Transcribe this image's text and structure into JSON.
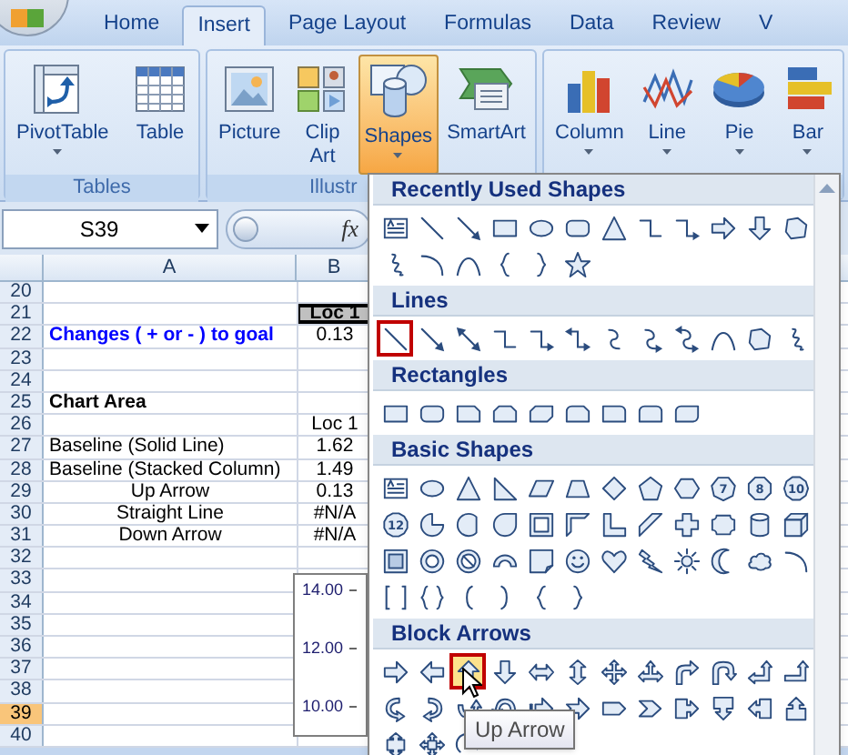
{
  "ribbon_tabs": [
    {
      "label": "Home",
      "selected": false
    },
    {
      "label": "Insert",
      "selected": true
    },
    {
      "label": "Page Layout",
      "selected": false
    },
    {
      "label": "Formulas",
      "selected": false
    },
    {
      "label": "Data",
      "selected": false
    },
    {
      "label": "Review",
      "selected": false
    },
    {
      "label": "V",
      "selected": false
    }
  ],
  "ribbon_groups": [
    {
      "label": "Tables",
      "buttons": [
        {
          "kind": "pivot-table",
          "label": "PivotTable",
          "has_menu": true,
          "selected": false
        },
        {
          "kind": "table",
          "label": "Table",
          "has_menu": false,
          "selected": false
        }
      ]
    },
    {
      "label": "Illustr",
      "buttons": [
        {
          "kind": "picture",
          "label": "Picture",
          "has_menu": false,
          "selected": false
        },
        {
          "kind": "clip-art",
          "label": "Clip Art",
          "has_menu": false,
          "selected": false
        },
        {
          "kind": "shapes",
          "label": "Shapes",
          "has_menu": true,
          "selected": true
        },
        {
          "kind": "smartart",
          "label": "SmartArt",
          "has_menu": false,
          "selected": false
        }
      ]
    },
    {
      "buttons": [
        {
          "kind": "column-chart",
          "label": "Column",
          "has_menu": true,
          "selected": false
        },
        {
          "kind": "line-chart",
          "label": "Line",
          "has_menu": true,
          "selected": false
        },
        {
          "kind": "pie-chart",
          "label": "Pie",
          "has_menu": true,
          "selected": false
        },
        {
          "kind": "bar-chart",
          "label": "Bar",
          "has_menu": true,
          "selected": false
        }
      ]
    }
  ],
  "name_box": {
    "value": "S39"
  },
  "formula_bar": {
    "function_label": "fx"
  },
  "sheet": {
    "columns": [
      {
        "label": "A"
      },
      {
        "label": "B"
      }
    ],
    "rows": [
      {
        "number": "20",
        "selected": false
      },
      {
        "number": "21",
        "selected": false,
        "b": {
          "text": "Loc 1",
          "kind": "header"
        }
      },
      {
        "number": "22",
        "selected": false,
        "a": {
          "text": "Changes ( + or - ) to goal",
          "kind": "goal"
        },
        "b": {
          "text": "0.13",
          "kind": "value"
        }
      },
      {
        "number": "23",
        "selected": false
      },
      {
        "number": "24",
        "selected": false
      },
      {
        "number": "25",
        "selected": false,
        "a": {
          "text": "Chart Area",
          "kind": "title"
        }
      },
      {
        "number": "26",
        "selected": false,
        "b": {
          "text": "Loc 1",
          "kind": "value"
        }
      },
      {
        "number": "27",
        "selected": false,
        "a": {
          "text": "Baseline (Solid Line)",
          "kind": "plain"
        },
        "b": {
          "text": "1.62",
          "kind": "value"
        }
      },
      {
        "number": "28",
        "selected": false,
        "a": {
          "text": "Baseline (Stacked Column)",
          "kind": "plain"
        },
        "b": {
          "text": "1.49",
          "kind": "value"
        }
      },
      {
        "number": "29",
        "selected": false,
        "a": {
          "text": "Up Arrow",
          "kind": "centered"
        },
        "b": {
          "text": "0.13",
          "kind": "value"
        }
      },
      {
        "number": "30",
        "selected": false,
        "a": {
          "text": "Straight Line",
          "kind": "centered"
        },
        "b": {
          "text": "#N/A",
          "kind": "value"
        }
      },
      {
        "number": "31",
        "selected": false,
        "a": {
          "text": "Down Arrow",
          "kind": "centered"
        },
        "b": {
          "text": "#N/A",
          "kind": "value"
        }
      },
      {
        "number": "32",
        "selected": false
      },
      {
        "number": "33",
        "selected": false
      },
      {
        "number": "34",
        "selected": false
      },
      {
        "number": "35",
        "selected": false
      },
      {
        "number": "36",
        "selected": false
      },
      {
        "number": "37",
        "selected": false
      },
      {
        "number": "38",
        "selected": false
      },
      {
        "number": "39",
        "selected": true
      },
      {
        "number": "40",
        "selected": false
      }
    ]
  },
  "chart": {
    "axis_labels": [
      "14.00",
      "12.00",
      "10.00"
    ]
  },
  "shapes_menu": {
    "tooltip": "Up Arrow",
    "sections": [
      {
        "title": "Recently Used Shapes",
        "items": [
          {
            "kind": "text-box",
            "hovered": false,
            "marked": false
          },
          {
            "kind": "line",
            "hovered": false,
            "marked": false
          },
          {
            "kind": "arrow",
            "hovered": false,
            "marked": false
          },
          {
            "kind": "rectangle",
            "hovered": false,
            "marked": false
          },
          {
            "kind": "oval",
            "hovered": false,
            "marked": false
          },
          {
            "kind": "rounded-rectangle",
            "hovered": false,
            "marked": false
          },
          {
            "kind": "triangle",
            "hovered": false,
            "marked": false
          },
          {
            "kind": "elbow-connector",
            "hovered": false,
            "marked": false
          },
          {
            "kind": "elbow-arrow",
            "hovered": false,
            "marked": false
          },
          {
            "kind": "right-arrow",
            "hovered": false,
            "marked": false
          },
          {
            "kind": "down-arrow",
            "hovered": false,
            "marked": false
          },
          {
            "kind": "freeform",
            "hovered": false,
            "marked": false
          },
          {
            "kind": "scribble",
            "hovered": false,
            "marked": false
          },
          {
            "kind": "arc",
            "hovered": false,
            "marked": false
          },
          {
            "kind": "curve",
            "hovered": false,
            "marked": false
          },
          {
            "kind": "left-brace",
            "hovered": false,
            "marked": false
          },
          {
            "kind": "right-brace",
            "hovered": false,
            "marked": false
          },
          {
            "kind": "star",
            "hovered": false,
            "marked": false
          }
        ]
      },
      {
        "title": "Lines",
        "items": [
          {
            "kind": "line",
            "hovered": false,
            "marked": true
          },
          {
            "kind": "arrow",
            "hovered": false,
            "marked": false
          },
          {
            "kind": "double-arrow",
            "hovered": false,
            "marked": false
          },
          {
            "kind": "elbow-connector",
            "hovered": false,
            "marked": false
          },
          {
            "kind": "elbow-arrow",
            "hovered": false,
            "marked": false
          },
          {
            "kind": "elbow-double-arrow",
            "hovered": false,
            "marked": false
          },
          {
            "kind": "curved-connector",
            "hovered": false,
            "marked": false
          },
          {
            "kind": "curved-arrow-connector",
            "hovered": false,
            "marked": false
          },
          {
            "kind": "curved-double-arrow",
            "hovered": false,
            "marked": false
          },
          {
            "kind": "curve",
            "hovered": false,
            "marked": false
          },
          {
            "kind": "freeform",
            "hovered": false,
            "marked": false
          },
          {
            "kind": "scribble",
            "hovered": false,
            "marked": false
          }
        ]
      },
      {
        "title": "Rectangles",
        "items": [
          {
            "kind": "rectangle",
            "hovered": false,
            "marked": false
          },
          {
            "kind": "rounded-rectangle",
            "hovered": false,
            "marked": false
          },
          {
            "kind": "snip-corner-rectangle",
            "hovered": false,
            "marked": false
          },
          {
            "kind": "snip-same-side-rectangle",
            "hovered": false,
            "marked": false
          },
          {
            "kind": "snip-diagonal-rectangle",
            "hovered": false,
            "marked": false
          },
          {
            "kind": "snip-round-rectangle",
            "hovered": false,
            "marked": false
          },
          {
            "kind": "round-corner-rectangle",
            "hovered": false,
            "marked": false
          },
          {
            "kind": "round-same-side-rectangle",
            "hovered": false,
            "marked": false
          },
          {
            "kind": "round-diagonal-rectangle",
            "hovered": false,
            "marked": false
          }
        ]
      },
      {
        "title": "Basic Shapes",
        "items": [
          {
            "kind": "text-box",
            "hovered": false,
            "marked": false
          },
          {
            "kind": "oval",
            "hovered": false,
            "marked": false
          },
          {
            "kind": "triangle",
            "hovered": false,
            "marked": false
          },
          {
            "kind": "right-triangle",
            "hovered": false,
            "marked": false
          },
          {
            "kind": "parallelogram",
            "hovered": false,
            "marked": false
          },
          {
            "kind": "trapezoid",
            "hovered": false,
            "marked": false
          },
          {
            "kind": "diamond",
            "hovered": false,
            "marked": false
          },
          {
            "kind": "pentagon",
            "hovered": false,
            "marked": false
          },
          {
            "kind": "hexagon",
            "hovered": false,
            "marked": false
          },
          {
            "kind": "heptagon",
            "label": "7",
            "hovered": false,
            "marked": false
          },
          {
            "kind": "octagon",
            "label": "8",
            "hovered": false,
            "marked": false
          },
          {
            "kind": "decagon",
            "label": "10",
            "hovered": false,
            "marked": false
          },
          {
            "kind": "dodecagon",
            "label": "12",
            "hovered": false,
            "marked": false
          },
          {
            "kind": "pie",
            "hovered": false,
            "marked": false
          },
          {
            "kind": "chord",
            "hovered": false,
            "marked": false
          },
          {
            "kind": "teardrop",
            "hovered": false,
            "marked": false
          },
          {
            "kind": "frame",
            "hovered": false,
            "marked": false
          },
          {
            "kind": "half-frame",
            "hovered": false,
            "marked": false
          },
          {
            "kind": "l-shape",
            "hovered": false,
            "marked": false
          },
          {
            "kind": "diagonal-stripe",
            "hovered": false,
            "marked": false
          },
          {
            "kind": "cross",
            "hovered": false,
            "marked": false
          },
          {
            "kind": "plaque",
            "hovered": false,
            "marked": false
          },
          {
            "kind": "can",
            "hovered": false,
            "marked": false
          },
          {
            "kind": "cube",
            "hovered": false,
            "marked": false
          },
          {
            "kind": "bevel",
            "hovered": false,
            "marked": false
          },
          {
            "kind": "donut",
            "hovered": false,
            "marked": false
          },
          {
            "kind": "no-symbol",
            "hovered": false,
            "marked": false
          },
          {
            "kind": "block-arc",
            "hovered": false,
            "marked": false
          },
          {
            "kind": "folded-corner",
            "hovered": false,
            "marked": false
          },
          {
            "kind": "smiley",
            "hovered": false,
            "marked": false
          },
          {
            "kind": "heart",
            "hovered": false,
            "marked": false
          },
          {
            "kind": "lightning",
            "hovered": false,
            "marked": false
          },
          {
            "kind": "sun",
            "hovered": false,
            "marked": false
          },
          {
            "kind": "moon",
            "hovered": false,
            "marked": false
          },
          {
            "kind": "cloud",
            "hovered": false,
            "marked": false
          },
          {
            "kind": "arc",
            "hovered": false,
            "marked": false
          },
          {
            "kind": "bracket-pair",
            "hovered": false,
            "marked": false
          },
          {
            "kind": "brace-pair",
            "hovered": false,
            "marked": false
          },
          {
            "kind": "left-bracket",
            "hovered": false,
            "marked": false
          },
          {
            "kind": "right-bracket",
            "hovered": false,
            "marked": false
          },
          {
            "kind": "left-brace",
            "hovered": false,
            "marked": false
          },
          {
            "kind": "right-brace",
            "hovered": false,
            "marked": false
          }
        ]
      },
      {
        "title": "Block Arrows",
        "items": [
          {
            "kind": "right-arrow",
            "hovered": false,
            "marked": false
          },
          {
            "kind": "left-arrow",
            "hovered": false,
            "marked": false
          },
          {
            "kind": "up-arrow",
            "hovered": true,
            "marked": true
          },
          {
            "kind": "down-arrow",
            "hovered": false,
            "marked": false
          },
          {
            "kind": "left-right-arrow",
            "hovered": false,
            "marked": false
          },
          {
            "kind": "up-down-arrow",
            "hovered": false,
            "marked": false
          },
          {
            "kind": "quad-arrow",
            "hovered": false,
            "marked": false
          },
          {
            "kind": "left-right-up-arrow",
            "hovered": false,
            "marked": false
          },
          {
            "kind": "bent-arrow",
            "hovered": false,
            "marked": false
          },
          {
            "kind": "u-turn-arrow",
            "hovered": false,
            "marked": false
          },
          {
            "kind": "left-up-arrow",
            "hovered": false,
            "marked": false
          },
          {
            "kind": "bent-up-arrow",
            "hovered": false,
            "marked": false
          },
          {
            "kind": "curved-right-arrow",
            "hovered": false,
            "marked": false
          },
          {
            "kind": "curved-left-arrow",
            "hovered": false,
            "marked": false
          },
          {
            "kind": "curved-up-arrow",
            "hovered": false,
            "marked": false
          },
          {
            "kind": "curved-down-arrow",
            "hovered": false,
            "marked": false
          },
          {
            "kind": "striped-right-arrow",
            "hovered": false,
            "marked": false
          },
          {
            "kind": "notched-right-arrow",
            "hovered": false,
            "marked": false
          },
          {
            "kind": "pentagon-arrow",
            "hovered": false,
            "marked": false
          },
          {
            "kind": "chevron",
            "hovered": false,
            "marked": false
          },
          {
            "kind": "right-arrow-callout",
            "hovered": false,
            "marked": false
          },
          {
            "kind": "down-arrow-callout",
            "hovered": false,
            "marked": false
          },
          {
            "kind": "left-arrow-callout",
            "hovered": false,
            "marked": false
          },
          {
            "kind": "up-arrow-callout",
            "hovered": false,
            "marked": false
          },
          {
            "kind": "left-right-arrow-callout",
            "hovered": false,
            "marked": false
          },
          {
            "kind": "quad-arrow-callout",
            "hovered": false,
            "marked": false
          },
          {
            "kind": "circular-arrow",
            "hovered": false,
            "marked": false
          }
        ]
      }
    ]
  }
}
